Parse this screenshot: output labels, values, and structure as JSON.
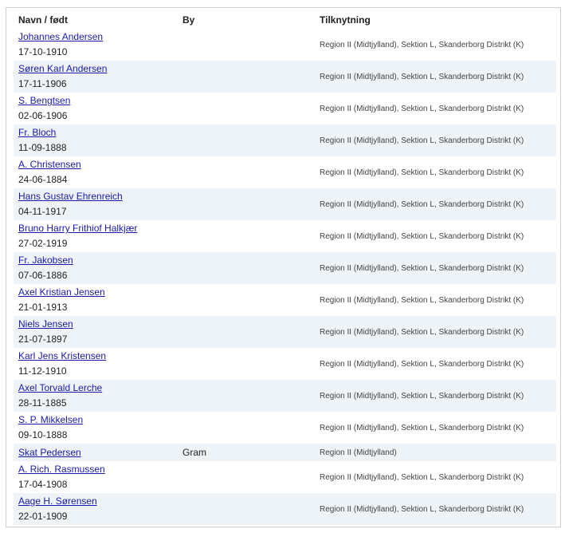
{
  "table": {
    "headers": {
      "name": "Navn / født",
      "city": "By",
      "affiliation": "Tilknytning"
    },
    "rows": [
      {
        "name": "Johannes Andersen",
        "born": "17-10-1910",
        "city": "",
        "affiliation": "Region II (Midtjylland), Sektion L, Skanderborg Distrikt (K)"
      },
      {
        "name": "Søren Karl Andersen",
        "born": "17-11-1906",
        "city": "",
        "affiliation": "Region II (Midtjylland), Sektion L, Skanderborg Distrikt (K)"
      },
      {
        "name": "S. Bengtsen",
        "born": "02-06-1906",
        "city": "",
        "affiliation": "Region II (Midtjylland), Sektion L, Skanderborg Distrikt (K)"
      },
      {
        "name": "Fr. Bloch",
        "born": "11-09-1888",
        "city": "",
        "affiliation": "Region II (Midtjylland), Sektion L, Skanderborg Distrikt (K)"
      },
      {
        "name": "A. Christensen",
        "born": "24-06-1884",
        "city": "",
        "affiliation": "Region II (Midtjylland), Sektion L, Skanderborg Distrikt (K)"
      },
      {
        "name": "Hans Gustav Ehrenreich",
        "born": "04-11-1917",
        "city": "",
        "affiliation": "Region II (Midtjylland), Sektion L, Skanderborg Distrikt (K)"
      },
      {
        "name": "Bruno Harry Frithiof Halkjær",
        "born": "27-02-1919",
        "city": "",
        "affiliation": "Region II (Midtjylland), Sektion L, Skanderborg Distrikt (K)"
      },
      {
        "name": "Fr. Jakobsen",
        "born": "07-06-1886",
        "city": "",
        "affiliation": "Region II (Midtjylland), Sektion L, Skanderborg Distrikt (K)"
      },
      {
        "name": "Axel Kristian Jensen",
        "born": "21-01-1913",
        "city": "",
        "affiliation": "Region II (Midtjylland), Sektion L, Skanderborg Distrikt (K)"
      },
      {
        "name": "Niels Jensen",
        "born": "21-07-1897",
        "city": "",
        "affiliation": "Region II (Midtjylland), Sektion L, Skanderborg Distrikt (K)"
      },
      {
        "name": "Karl Jens Kristensen",
        "born": "11-12-1910",
        "city": "",
        "affiliation": "Region II (Midtjylland), Sektion L, Skanderborg Distrikt (K)"
      },
      {
        "name": "Axel Torvald Lerche",
        "born": "28-11-1885",
        "city": "",
        "affiliation": "Region II (Midtjylland), Sektion L, Skanderborg Distrikt (K)"
      },
      {
        "name": "S. P. Mikkelsen",
        "born": "09-10-1888",
        "city": "",
        "affiliation": "Region II (Midtjylland), Sektion L, Skanderborg Distrikt (K)"
      },
      {
        "name": "Skat Pedersen",
        "born": "",
        "city": "Gram",
        "affiliation": "Region II (Midtjylland)"
      },
      {
        "name": "A. Rich. Rasmussen",
        "born": "17-04-1908",
        "city": "",
        "affiliation": "Region II (Midtjylland), Sektion L, Skanderborg Distrikt (K)"
      },
      {
        "name": "Aage H. Sørensen",
        "born": "22-01-1909",
        "city": "",
        "affiliation": "Region II (Midtjylland), Sektion L, Skanderborg Distrikt (K)"
      }
    ]
  },
  "colors": {
    "link": "#1a1aa6",
    "row_alt": "#eef3f8",
    "border": "#cfcfcf"
  }
}
